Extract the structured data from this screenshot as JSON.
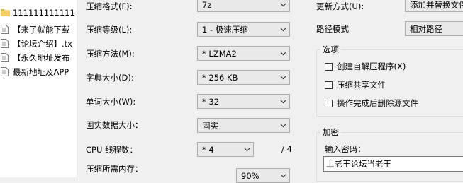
{
  "file_list": [
    {
      "icon": "folder-icon",
      "name": "111111111111"
    },
    {
      "icon": "document-icon",
      "name": "【来了就能下载"
    },
    {
      "icon": "document-icon",
      "name": "【论坛介绍】.tx"
    },
    {
      "icon": "document-icon",
      "name": "【永久地址发布"
    },
    {
      "icon": "document-icon",
      "name": "最新地址及APP"
    }
  ],
  "settings": {
    "archive_format": {
      "label": "压缩格式(F):",
      "value": "7z"
    },
    "compression_level": {
      "label": "压缩等级(L):",
      "value": "1 - 极速压缩"
    },
    "compression_method": {
      "label": "压缩方法(M):",
      "value": "* LZMA2"
    },
    "dictionary_size": {
      "label": "字典大小(D):",
      "value": "* 256 KB"
    },
    "word_size": {
      "label": "单词大小(W):",
      "value": "* 32"
    },
    "solid_block_size": {
      "label": "固实数据大小：",
      "value": "固实"
    },
    "cpu_threads": {
      "label": "CPU 线程数：",
      "value": "* 4",
      "max": "/ 4"
    },
    "memory_usage": {
      "label": "压缩所需内存：",
      "value": "90%"
    }
  },
  "right_panel": {
    "update_mode": {
      "label": "更新方式(U):",
      "value": "添加并替换文件"
    },
    "path_mode": {
      "label": "路径模式",
      "value": "相对路径"
    },
    "options": {
      "title": "选项",
      "items": [
        {
          "label": "创建自解压程序(X)",
          "checked": false
        },
        {
          "label": "压缩共享文件",
          "checked": false
        },
        {
          "label": "操作完成后删除源文件",
          "checked": false
        }
      ]
    },
    "encryption": {
      "title": "加密",
      "password_label": "输入密码：",
      "password_value": "上老王论坛当老王"
    }
  }
}
